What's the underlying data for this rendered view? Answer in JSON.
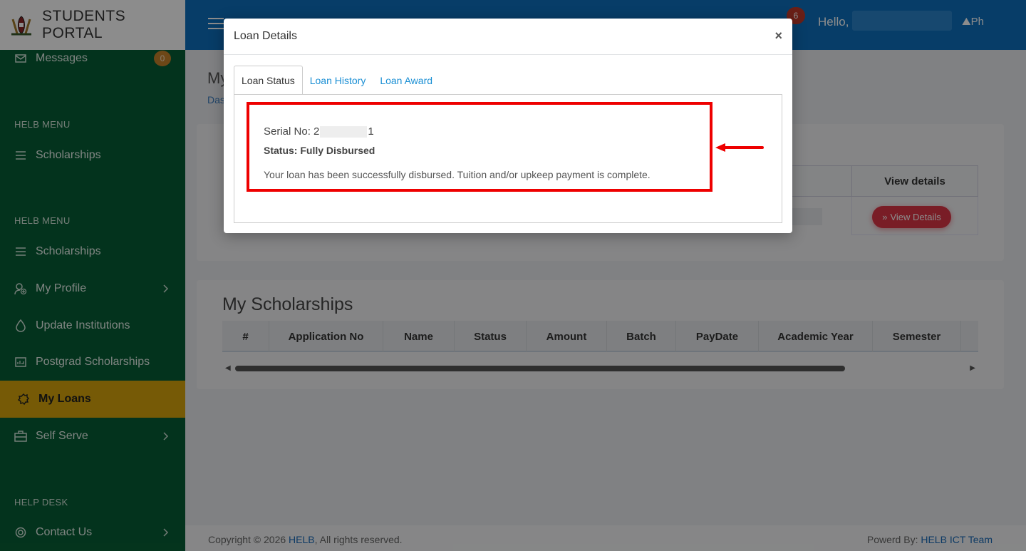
{
  "brand": {
    "title": "STUDENTS PORTAL"
  },
  "sidebar": {
    "messages": {
      "label": "Messages",
      "badge": "0"
    },
    "sections": [
      {
        "heading": "HELB MENU"
      },
      {
        "heading": "HELB MENU"
      },
      {
        "heading": "HELP DESK"
      }
    ],
    "items": [
      {
        "label": "Scholarships",
        "icon": "list-icon"
      },
      {
        "label": "Scholarships",
        "icon": "list-icon"
      },
      {
        "label": "My Profile",
        "icon": "profile-icon"
      },
      {
        "label": "Update Institutions",
        "icon": "drop-icon"
      },
      {
        "label": "Postgrad Scholarships",
        "icon": "dashboard-icon"
      },
      {
        "label": "My Loans",
        "icon": "loans-icon"
      },
      {
        "label": "Self Serve",
        "icon": "briefcase-icon"
      },
      {
        "label": "Contact Us",
        "icon": "support-icon"
      }
    ]
  },
  "header": {
    "notifications": "6",
    "greeting": "Hello,",
    "photo_alt": "Ph"
  },
  "page": {
    "title": "My",
    "breadcrumb": "Das"
  },
  "loans_table": {
    "view_details_header": "View details",
    "view_button": "View Details"
  },
  "scholarships": {
    "title": "My Scholarships",
    "columns": [
      "#",
      "Application No",
      "Name",
      "Status",
      "Amount",
      "Batch",
      "PayDate",
      "Academic Year",
      "Semester"
    ]
  },
  "footer": {
    "copyright": "Copyright © 2026",
    "org": "HELB",
    "rights": ", All rights reserved.",
    "powered": "Powerd By:",
    "team": "HELB ICT Team"
  },
  "modal": {
    "title": "Loan Details",
    "close": "×",
    "tabs": [
      "Loan Status",
      "Loan History",
      "Loan Award"
    ],
    "serial_label": "Serial No: 2",
    "serial_end": "1",
    "status": "Status: Fully Disbursed",
    "message": "Your loan has been successfully disbursed. Tuition and/or upkeep payment is complete."
  },
  "colors": {
    "sidebar": "#075e35",
    "active": "#d7a50b",
    "header": "#0d6fbd",
    "highlight": "#ee0000"
  }
}
